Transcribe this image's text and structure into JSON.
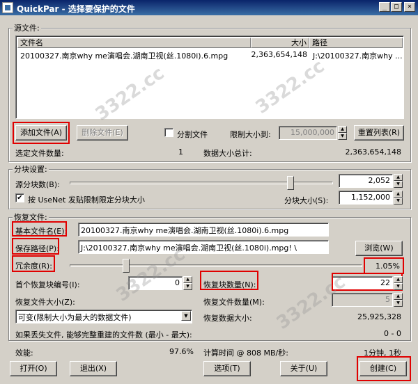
{
  "window": {
    "title": "QuickPar - 选择要保护的文件",
    "minimize": "_",
    "maximize": "□",
    "close": "×"
  },
  "source": {
    "group_label": "源文件:",
    "col_name": "文件名",
    "col_size": "大小",
    "col_path": "路径",
    "rows": [
      {
        "name": "20100327.南京why me演唱会.湖南卫视(丝.1080i).6.mpg",
        "size": "2,363,654,148",
        "path": "J:\\20100327.南京why ..."
      }
    ],
    "add_button": "添加文件(A)",
    "remove_button": "删除文件(E)",
    "split_label": "分割文件",
    "limit_label": "限制大小到:",
    "limit_value": "15,000,000",
    "reset_button": "重置列表(R)",
    "selected_count_label": "选定文件数量:",
    "selected_count": "1",
    "total_size_label": "数据大小总计:",
    "total_size": "2,363,654,148"
  },
  "blocks": {
    "group_label": "分块设置:",
    "source_count_label": "源分块数(B):",
    "source_count": "2,052",
    "usenet_label": "按 UseNet 发贴限制限定分块大小",
    "usenet_checked": "✔",
    "block_size_label": "分块大小(S):",
    "block_size": "1,152,000"
  },
  "recovery": {
    "group_label": "恢复文件:",
    "basename_label": "基本文件名(E):",
    "basename_value": "20100327.南京why me演唱会.湖南卫视(丝.1080i).6.mpg",
    "savepath_label": "保存路径(P):",
    "savepath_value": "J:\\20100327.南京why me演唱会.湖南卫视(丝.1080i).mpg! \\",
    "browse_button": "浏览(W)",
    "redundancy_label": "冗余度(R):",
    "redundancy_value": "1.05%",
    "first_block_label": "首个恢复块编号(I):",
    "first_block_value": "0",
    "block_count_label": "恢复块数量(N):",
    "block_count_value": "22",
    "file_size_label": "恢复文件大小(Z):",
    "file_count_label": "恢复文件数量(M):",
    "file_count_value": "5",
    "size_mode_value": "可变(限制大小为最大的数据文件)",
    "data_size_label": "恢复数据大小:",
    "data_size_value": "25,925,328",
    "rebuild_label": "如果丢失文件, 能够完整重建的文件数 (最小 - 最大):",
    "rebuild_value": "0 - 0"
  },
  "footer": {
    "efficiency_label": "效能:",
    "efficiency_value": "97.6%",
    "calc_label": "计算时间 @ 808 MB/秒:",
    "calc_value": "1分钟, 1秒",
    "open_button": "打开(O)",
    "exit_button": "退出(X)",
    "options_button": "选项(T)",
    "about_button": "关于(U)",
    "create_button": "创建(C)"
  },
  "watermark": "3322.cc"
}
